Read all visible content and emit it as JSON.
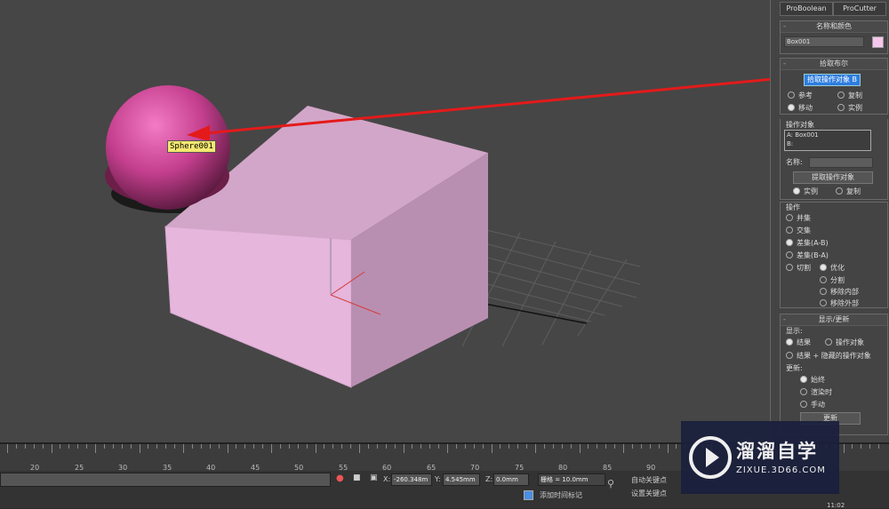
{
  "scene": {
    "sphere_label": "Sphere001"
  },
  "panel": {
    "tabs": [
      "ProBoolean",
      "ProCutter"
    ],
    "name_color": {
      "title": "名称和颜色",
      "object_name": "Box001",
      "swatch_color": "#f5c7ec"
    },
    "pick_boolean": {
      "title": "拾取布尔",
      "pick_button": "拾取操作对象 B",
      "options": [
        {
          "label": "参考",
          "selected": false
        },
        {
          "label": "复制",
          "selected": false
        },
        {
          "label": "移动",
          "selected": true
        },
        {
          "label": "实例",
          "selected": false
        }
      ]
    },
    "operands": {
      "title": "操作对象",
      "list": [
        "A: Box001",
        "B:"
      ],
      "name_label": "名称:",
      "extract_button": "提取操作对象",
      "options": [
        {
          "label": "实例",
          "selected": true
        },
        {
          "label": "复制",
          "selected": false
        }
      ]
    },
    "operation": {
      "title": "操作",
      "items": [
        {
          "label": "并集",
          "selected": false
        },
        {
          "label": "交集",
          "selected": false
        },
        {
          "label": "差集(A-B)",
          "selected": true
        },
        {
          "label": "差集(B-A)",
          "selected": false
        },
        {
          "label": "切割",
          "selected": false
        }
      ],
      "cut_options": [
        {
          "label": "优化",
          "selected": true
        },
        {
          "label": "分割",
          "selected": false
        },
        {
          "label": "移除内部",
          "selected": false
        },
        {
          "label": "移除外部",
          "selected": false
        }
      ]
    },
    "display_update": {
      "title": "显示/更新",
      "display_label": "显示:",
      "display_options": [
        {
          "label": "结果",
          "selected": true
        },
        {
          "label": "操作对象",
          "selected": false
        },
        {
          "label": "结果 + 隐藏的操作对象",
          "selected": false
        }
      ],
      "update_label": "更新:",
      "update_options": [
        {
          "label": "始终",
          "selected": true
        },
        {
          "label": "渲染时",
          "selected": false
        },
        {
          "label": "手动",
          "selected": false
        }
      ],
      "update_button": "更新"
    }
  },
  "timeline": {
    "labels": [
      "20",
      "25",
      "30",
      "35",
      "40",
      "45",
      "50",
      "55",
      "60",
      "65",
      "70",
      "75",
      "80",
      "85",
      "90"
    ]
  },
  "status": {
    "x_label": "X:",
    "x_value": "-260.348m",
    "y_label": "Y:",
    "y_value": "4.545mm",
    "z_label": "Z:",
    "z_value": "0.0mm",
    "grid": "栅格 = 10.0mm",
    "add_time_tag": "添加时间标记",
    "auto_key": "自动关键点",
    "set_key": "设置关键点",
    "clock": "11:02"
  },
  "watermark": {
    "brand": "溜溜自学",
    "url": "ZIXUE.3D66.COM"
  }
}
